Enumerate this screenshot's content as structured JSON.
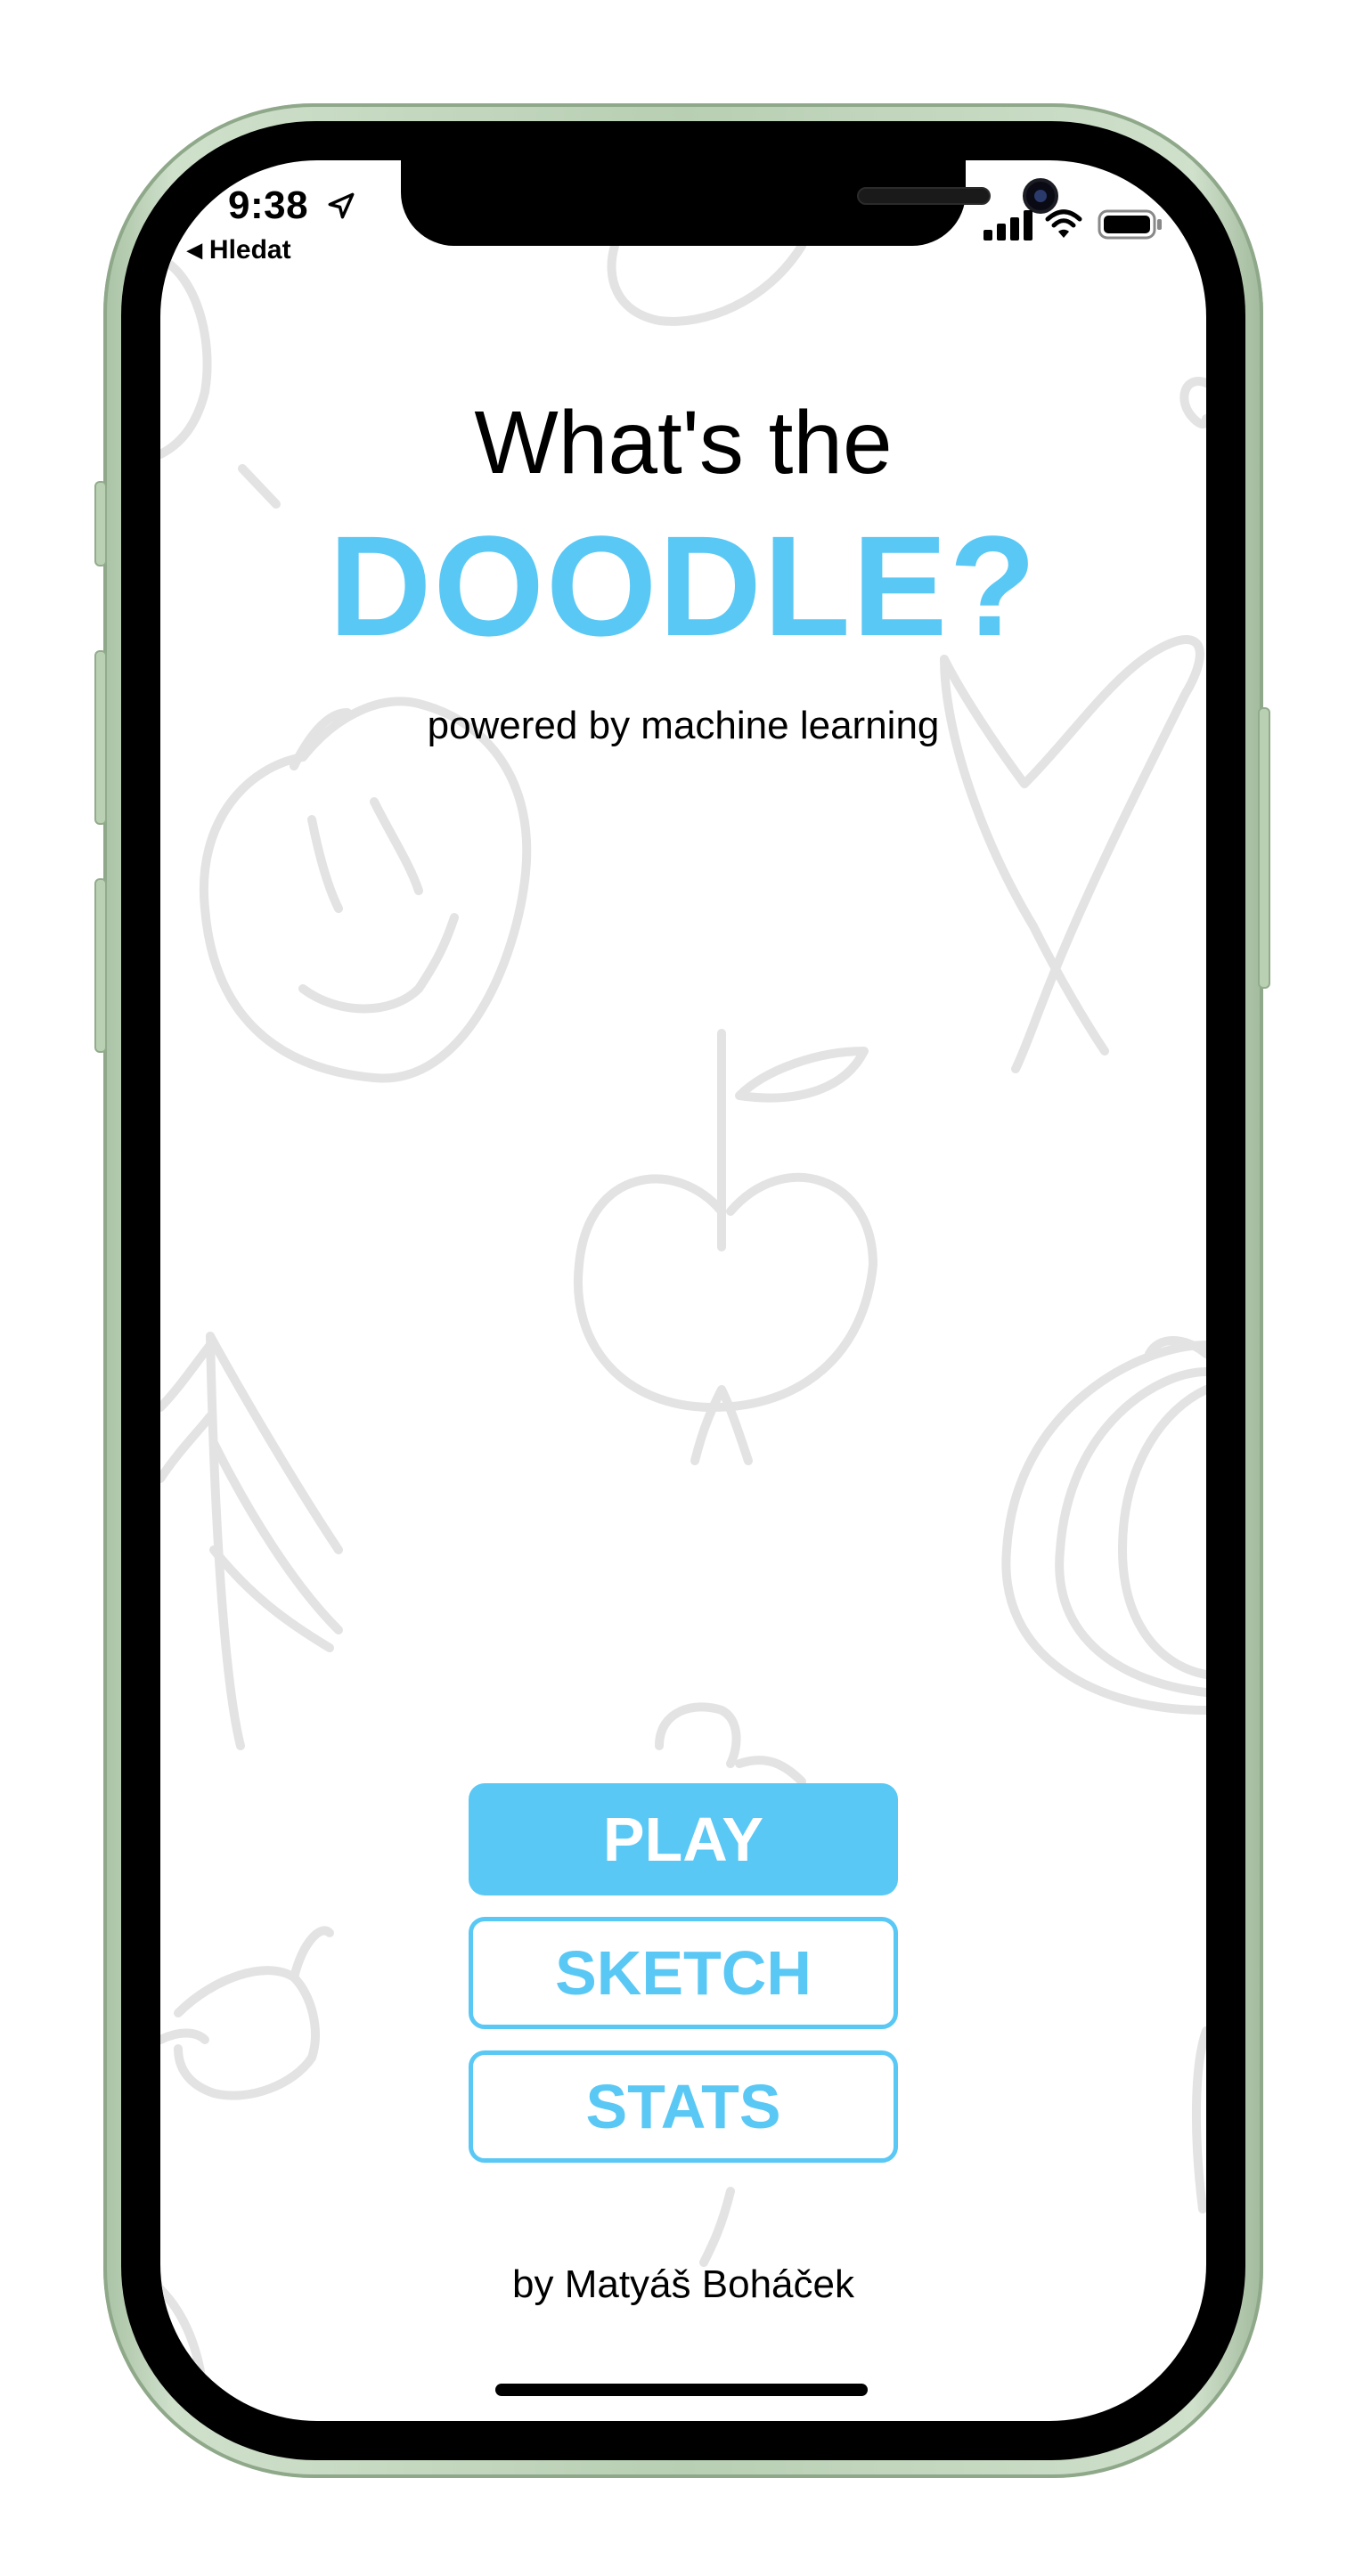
{
  "status_bar": {
    "time": "9:38",
    "back_label": "Hledat",
    "icons": [
      "location-arrow-icon",
      "cellular-signal-icon",
      "wifi-icon",
      "battery-icon"
    ]
  },
  "header": {
    "title_line1": "What's the",
    "title_line2": "DOODLE?",
    "subtitle": "powered by machine learning"
  },
  "menu": {
    "play_label": "PLAY",
    "sketch_label": "SKETCH",
    "stats_label": "STATS"
  },
  "footer": {
    "author": "by Matyáš Boháček"
  },
  "colors": {
    "accent": "#5ac8f5",
    "doodle_stroke": "#e3e3e3",
    "text": "#000000",
    "frame": "#b8cfb3"
  }
}
